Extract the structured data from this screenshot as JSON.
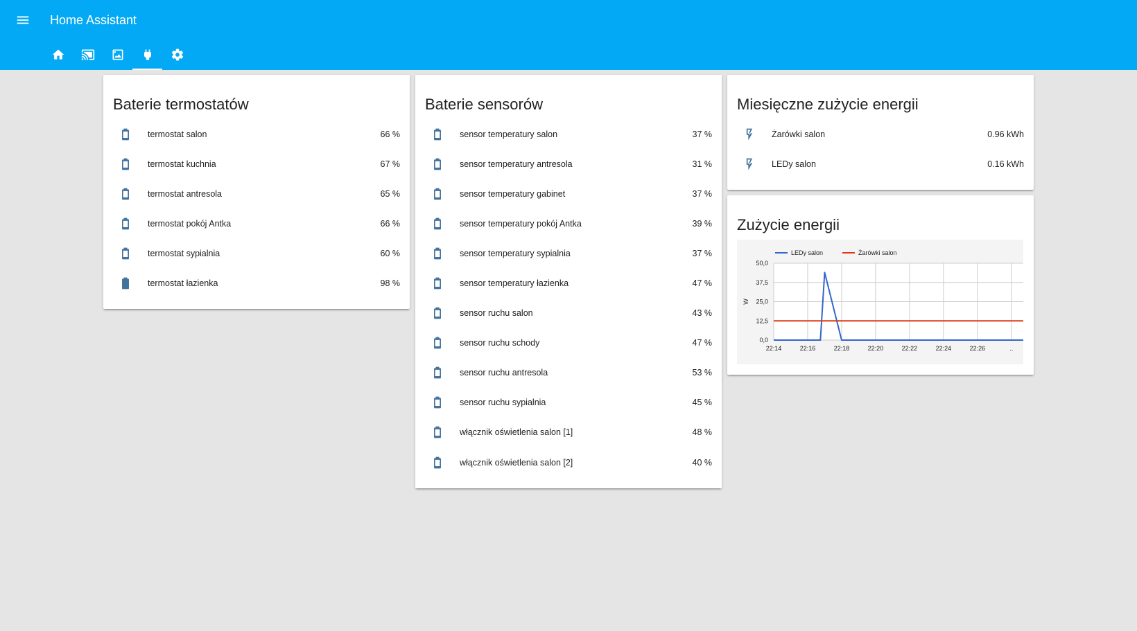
{
  "app": {
    "title": "Home Assistant"
  },
  "tabs": [
    {
      "icon": "home-icon"
    },
    {
      "icon": "cast-icon"
    },
    {
      "icon": "image-icon"
    },
    {
      "icon": "plug-icon",
      "active": true
    },
    {
      "icon": "settings-icon"
    }
  ],
  "cards": {
    "thermostats": {
      "title": "Baterie termostatów",
      "items": [
        {
          "name": "termostat salon",
          "value": "66 %"
        },
        {
          "name": "termostat kuchnia",
          "value": "67 %"
        },
        {
          "name": "termostat antresola",
          "value": "65 %"
        },
        {
          "name": "termostat pokój Antka",
          "value": "66 %"
        },
        {
          "name": "termostat sypialnia",
          "value": "60 %"
        },
        {
          "name": "termostat łazienka",
          "value": "98 %"
        }
      ]
    },
    "sensors": {
      "title": "Baterie sensorów",
      "items": [
        {
          "name": "sensor temperatury salon",
          "value": "37 %"
        },
        {
          "name": "sensor temperatury antresola",
          "value": "31 %"
        },
        {
          "name": "sensor temperatury gabinet",
          "value": "37 %"
        },
        {
          "name": "sensor temperatury pokój Antka",
          "value": "39 %"
        },
        {
          "name": "sensor temperatury sypialnia",
          "value": "37 %"
        },
        {
          "name": "sensor temperatury łazienka",
          "value": "47 %"
        },
        {
          "name": "sensor ruchu salon",
          "value": "43 %"
        },
        {
          "name": "sensor ruchu schody",
          "value": "47 %"
        },
        {
          "name": "sensor ruchu antresola",
          "value": "53 %"
        },
        {
          "name": "sensor ruchu sypialnia",
          "value": "45 %"
        },
        {
          "name": "włącznik oświetlenia salon [1]",
          "value": "48 %"
        },
        {
          "name": "włącznik oświetlenia salon [2]",
          "value": "40 %"
        }
      ]
    },
    "monthly_energy": {
      "title": "Miesięczne zużycie energii",
      "items": [
        {
          "name": "Żarówki salon",
          "value": "0.96 kWh"
        },
        {
          "name": "LEDy salon",
          "value": "0.16 kWh"
        }
      ]
    },
    "energy": {
      "title": "Zużycie energii"
    }
  },
  "colors": {
    "header": "#03a9f4",
    "icon": "#44739e",
    "series_leds": "#3366cc",
    "series_bulbs": "#dc3912"
  },
  "chart_data": {
    "type": "line",
    "ylabel": "W",
    "ylim": [
      0,
      50
    ],
    "yticks": [
      "0,0",
      "12,5",
      "25,0",
      "37,5",
      "50,0"
    ],
    "xticks": [
      "22:14",
      "22:16",
      "22:18",
      "22:20",
      "22:22",
      "22:24",
      "22:26",
      ".."
    ],
    "xlim": [
      0,
      14.7
    ],
    "legend_position": "top",
    "series": [
      {
        "name": "LEDy salon",
        "color": "#3366cc",
        "x": [
          0,
          2.6,
          2.75,
          3.0,
          4.0,
          14.7
        ],
        "y": [
          0,
          0,
          0,
          44,
          0,
          0
        ]
      },
      {
        "name": "Żarówki salon",
        "color": "#dc3912",
        "x": [
          0,
          14.7
        ],
        "y": [
          12.5,
          12.5
        ]
      }
    ]
  }
}
